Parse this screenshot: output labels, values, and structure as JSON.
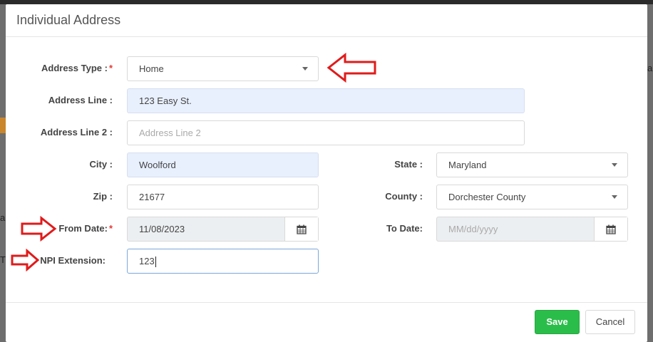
{
  "modal": {
    "title": "Individual Address"
  },
  "backdrop": {
    "right_fragment": "al",
    "left_fragment_1": "al",
    "left_fragment_2": "T"
  },
  "form": {
    "address_type": {
      "label": "Address Type :",
      "value": "Home",
      "required": "*"
    },
    "address_line": {
      "label": "Address Line :",
      "value": "123 Easy St."
    },
    "address_line2": {
      "label": "Address Line 2 :",
      "placeholder": "Address Line 2"
    },
    "city": {
      "label": "City :",
      "value": "Woolford"
    },
    "state": {
      "label": "State :",
      "value": "Maryland"
    },
    "zip": {
      "label": "Zip :",
      "value": "21677"
    },
    "county": {
      "label": "County :",
      "value": "Dorchester County"
    },
    "from_date": {
      "label": "From Date:",
      "value": "11/08/2023",
      "required": "*"
    },
    "to_date": {
      "label": "To Date:",
      "placeholder": "MM/dd/yyyy"
    },
    "npi_extension": {
      "label": "NPI Extension:",
      "value": "123"
    }
  },
  "footer": {
    "save_label": "Save",
    "cancel_label": "Cancel"
  },
  "colors": {
    "save_green": "#2bbd4a",
    "required_red": "#e53935",
    "arrow_red": "#e01b1b",
    "autofill_blue": "#e8f0fe"
  },
  "icons": {
    "calendar": "calendar-icon",
    "dropdown": "caret-down-icon",
    "annotation": "red-arrow-annotation"
  }
}
